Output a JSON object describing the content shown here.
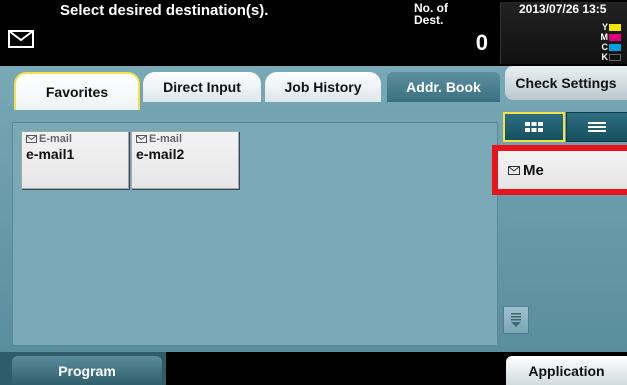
{
  "header": {
    "message": "Select desired destination(s).",
    "dest_label": "No. of\nDest.",
    "dest_count": "0",
    "datetime": "2013/07/26 13:5",
    "toner": [
      {
        "label": "Y",
        "color": "#f3e600"
      },
      {
        "label": "M",
        "color": "#e0007a"
      },
      {
        "label": "C",
        "color": "#00a0e0"
      },
      {
        "label": "K",
        "color": "#111111"
      }
    ]
  },
  "tabs": {
    "favorites": "Favorites",
    "direct_input": "Direct Input",
    "job_history": "Job History",
    "addr_book": "Addr. Book",
    "check_settings": "Check Settings"
  },
  "destinations": [
    {
      "type": "E-mail",
      "name": "e-mail1"
    },
    {
      "type": "E-mail",
      "name": "e-mail2"
    }
  ],
  "me_button": {
    "label": "Me"
  },
  "footer": {
    "program": "Program",
    "application": "Application"
  },
  "colors": {
    "panel": "#6f9fae",
    "highlight_red": "#e8141b",
    "tab_highlight_yellow": "#f2e24a"
  }
}
